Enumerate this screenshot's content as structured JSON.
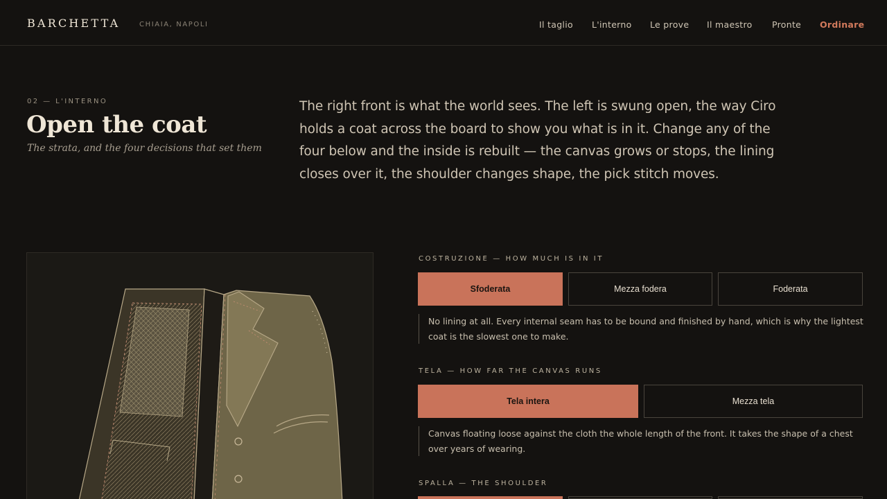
{
  "header": {
    "brand": "BARCHETTA",
    "location": "CHIAIA, NAPOLI",
    "nav": [
      "Il taglio",
      "L'interno",
      "Le prove",
      "Il maestro",
      "Pronte"
    ],
    "cta": "Ordinare"
  },
  "intro": {
    "kicker": "02 — L'INTERNO",
    "title": "Open the coat",
    "subtitle": "The strata, and the four decisions that set them",
    "lede": "The right front is what the world sees. The left is swung open, the way Ciro holds a coat across the board to show you what is in it. Change any of the four below and the inside is rebuilt — the canvas grows or stops, the lining closes over it, the shoulder changes shape, the pick stitch moves."
  },
  "groups": [
    {
      "label": "COSTRUZIONE — HOW MUCH IS IN IT",
      "options": [
        "Sfoderata",
        "Mezza fodera",
        "Foderata"
      ],
      "selected": "Sfoderata",
      "note": "No lining at all. Every internal seam has to be bound and finished by hand, which is why the lightest coat is the slowest one to make."
    },
    {
      "label": "TELA — HOW FAR THE CANVAS RUNS",
      "options": [
        "Tela intera",
        "Mezza tela"
      ],
      "selected": "Tela intera",
      "note": "Canvas floating loose against the cloth the whole length of the front. It takes the shape of a chest over years of wearing."
    },
    {
      "label": "SPALLA — THE SHOULDER",
      "options": [
        "",
        "",
        ""
      ],
      "selected": ""
    }
  ],
  "colors": {
    "background": "#141210",
    "accent": "#c9735a",
    "cloth": "#6e6548",
    "line": "#b8a988"
  }
}
